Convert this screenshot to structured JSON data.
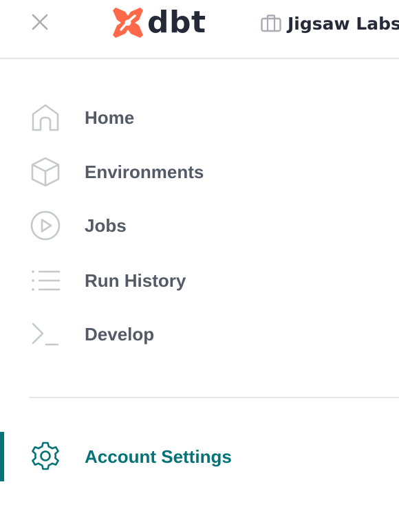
{
  "header": {
    "close_icon": "close-icon",
    "logo": {
      "text": "dbt",
      "mark_color": "#ff694a",
      "text_color": "#262a38"
    },
    "account": {
      "icon": "briefcase-icon",
      "name": "Jigsaw Labs"
    }
  },
  "nav": {
    "items": [
      {
        "label": "Home",
        "icon": "home-icon"
      },
      {
        "label": "Environments",
        "icon": "cube-icon"
      },
      {
        "label": "Jobs",
        "icon": "play-circle-icon"
      },
      {
        "label": "Run History",
        "icon": "list-icon"
      },
      {
        "label": "Develop",
        "icon": "terminal-icon"
      }
    ],
    "settings": {
      "label": "Account Settings",
      "icon": "gear-icon",
      "active": true
    }
  },
  "colors": {
    "accent": "#047377",
    "nav_text": "#545a66",
    "icon_gray": "#c6c8cc",
    "divider": "#e6e6e6",
    "brand": "#ff694a"
  }
}
